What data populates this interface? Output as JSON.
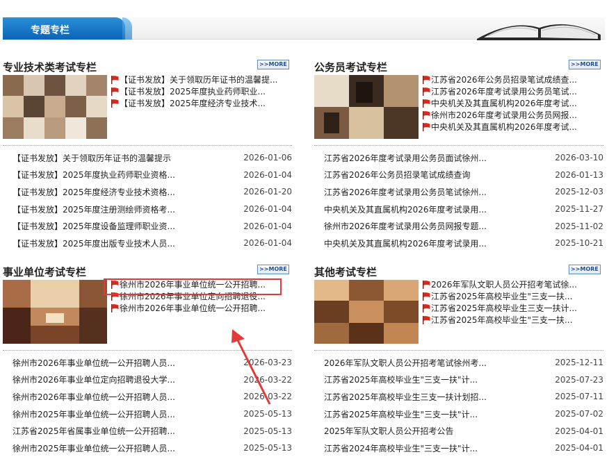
{
  "header": {
    "tab_label": "专题专栏"
  },
  "sections": [
    {
      "title": "专业技术类考试专栏",
      "more": ">>MORE",
      "flag_items": [
        "【证书发放】关于领取历年证书的温馨提...",
        "【证书发放】2025年度执业药师职业...",
        "【证书发放】2025年度经济专业技术..."
      ],
      "rows": [
        {
          "title": "【证书发放】关于领取历年证书的温馨提示",
          "date": "2026-01-06"
        },
        {
          "title": "【证书发放】2025年度执业药师职业资格...",
          "date": "2026-01-04"
        },
        {
          "title": "【证书发放】2025年度经济专业技术资格...",
          "date": "2026-01-20"
        },
        {
          "title": "【证书发放】2025年度注册测绘师资格考...",
          "date": "2026-01-04"
        },
        {
          "title": "【证书发放】2025年度设备监理师职业资...",
          "date": "2026-01-04"
        },
        {
          "title": "【证书发放】2025年度出版专业技术人员...",
          "date": "2026-01-04"
        }
      ]
    },
    {
      "title": "公务员考试专栏",
      "more": ">>MORE",
      "flag_items": [
        "江苏省2026年公务员招录笔试成绩查...",
        "江苏省2026年度考试录用公务员笔试...",
        "中央机关及其直属机构2026年度考试...",
        "徐州市2026年度考试录用公务员网报...",
        "中央机关及其直属机构2026年度考试..."
      ],
      "rows": [
        {
          "title": "江苏省2026年度考试录用公务员面试徐州...",
          "date": "2026-03-10"
        },
        {
          "title": "江苏省2026年公务员招录笔试成绩查询",
          "date": "2026-01-13"
        },
        {
          "title": "江苏省2026年度考试录用公务员笔试徐州...",
          "date": "2025-12-03"
        },
        {
          "title": "中央机关及其直属机构2026年度考试录用...",
          "date": "2025-11-27"
        },
        {
          "title": "徐州市2026年度考试录用公务员网报专题...",
          "date": "2025-11-02"
        },
        {
          "title": "中央机关及其直属机构2026年度考试录用...",
          "date": "2025-10-21"
        }
      ]
    },
    {
      "title": "事业单位考试专栏",
      "more": ">>MORE",
      "flag_items": [
        "徐州市2026年事业单位统一公开招聘...",
        "徐州市2026年事业单位定向招聘退役...",
        "徐州市2026年事业单位统一公开招聘..."
      ],
      "rows": [
        {
          "title": "徐州市2026年事业单位统一公开招聘人员...",
          "date": "2026-03-23"
        },
        {
          "title": "徐州市2026年事业单位定向招聘退役大学...",
          "date": "2026-03-22"
        },
        {
          "title": "徐州市2026年事业单位统一公开招聘人员...",
          "date": "2026-03-22"
        },
        {
          "title": "徐州市2025年事业单位统一公开招聘人员...",
          "date": "2025-05-13"
        },
        {
          "title": "江苏省2025年省属事业单位统一公开招聘...",
          "date": "2025-05-13"
        },
        {
          "title": "徐州市2025年事业单位统一公开招聘人员...",
          "date": "2025-05-13"
        }
      ]
    },
    {
      "title": "其他考试专栏",
      "more": ">>MORE",
      "flag_items": [
        "2026年军队文职人员公开招考笔试徐...",
        "江苏省2025年高校毕业生\"三支一扶...",
        "江苏省2025年高校毕业生三支一扶计...",
        "江苏省2025年高校毕业生\"三支一扶..."
      ],
      "rows": [
        {
          "title": "2026年军队文职人员公开招考笔试徐州考...",
          "date": "2025-12-11"
        },
        {
          "title": "江苏省2025年高校毕业生\"三支一扶\"计...",
          "date": "2025-07-23"
        },
        {
          "title": "江苏省2025年高校毕业生三支一扶计划招...",
          "date": "2025-07-11"
        },
        {
          "title": "江苏省2025年高校毕业生\"三支一扶\"计...",
          "date": "2025-07-02"
        },
        {
          "title": "2025年军队文职人员公开招考公告",
          "date": "2025-04-01"
        },
        {
          "title": "江苏省2024年高校毕业生\"三支一扶\"计...",
          "date": "2025-04-01"
        }
      ]
    }
  ],
  "colors": {
    "accent_blue": "#0b64b8",
    "flag_red": "#d42a1f",
    "highlight_red": "#e03a3a"
  }
}
